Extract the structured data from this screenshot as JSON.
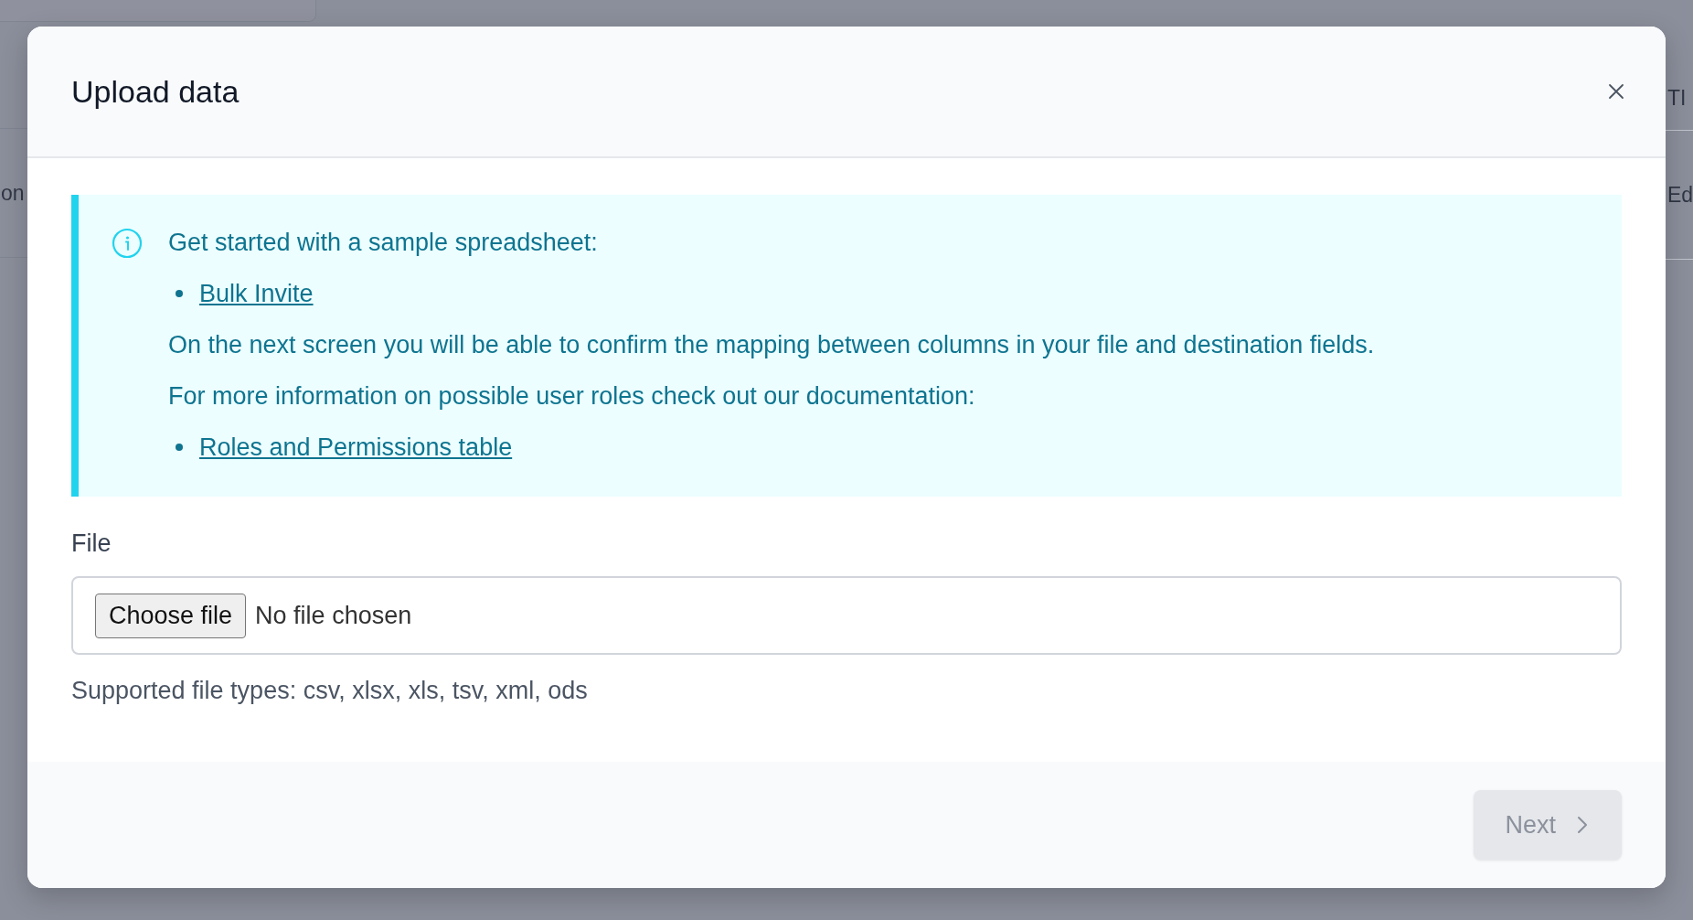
{
  "background": {
    "left_fragments": [
      "on"
    ],
    "right_fragments": [
      "TI",
      "Ed"
    ]
  },
  "dialog": {
    "title": "Upload data",
    "info": {
      "heading": "Get started with a sample spreadsheet:",
      "items": [
        {
          "kind": "link",
          "text": "Bulk Invite"
        },
        {
          "kind": "text",
          "text": "On the next screen you will be able to confirm the mapping between columns in your file and destination fields."
        },
        {
          "kind": "text",
          "text": "For more information on possible user roles check out our documentation:"
        },
        {
          "kind": "link",
          "text": "Roles and Permissions table"
        }
      ]
    },
    "file_field": {
      "label": "File",
      "button": "Choose file",
      "value": "No file chosen",
      "help": "Supported file types: csv, xlsx, xls, tsv, xml, ods"
    },
    "next_button": {
      "label": "Next",
      "disabled": true
    }
  }
}
